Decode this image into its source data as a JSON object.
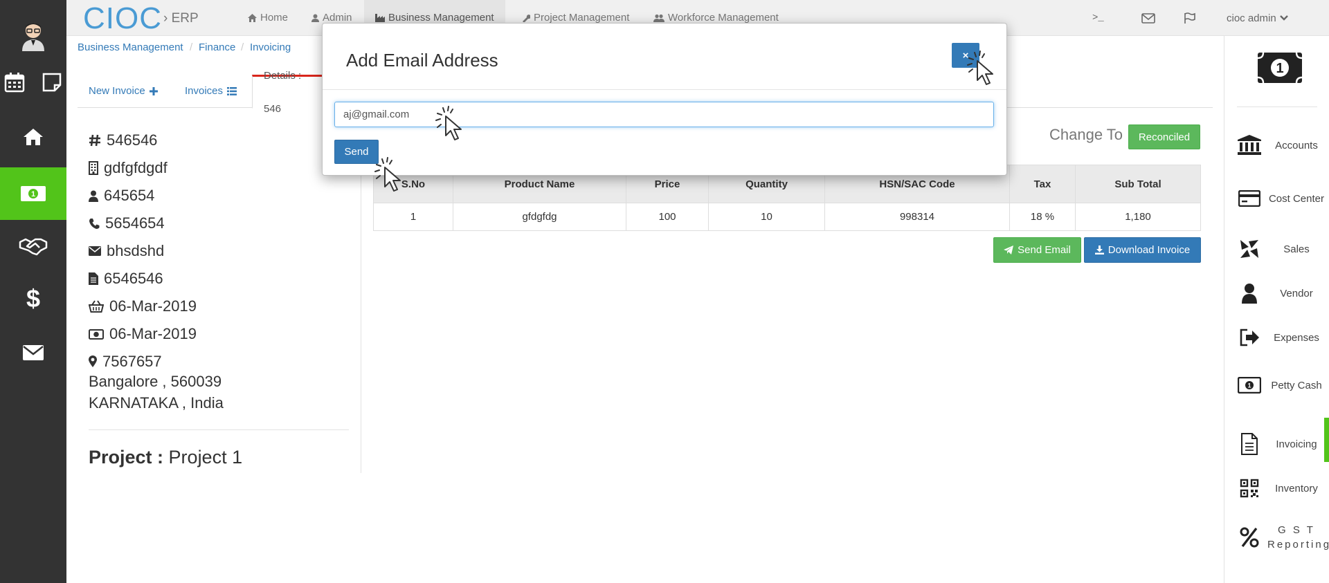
{
  "app": {
    "brand": "CIOC",
    "brand_sub": "ERP"
  },
  "topnav": {
    "items": [
      {
        "label": "Home",
        "icon": "home-icon"
      },
      {
        "label": "Admin",
        "icon": "user-icon"
      },
      {
        "label": "Business Management",
        "icon": "industry-icon",
        "active": true
      },
      {
        "label": "Project Management",
        "icon": "wrench-icon"
      },
      {
        "label": "Workforce Management",
        "icon": "users-icon"
      }
    ],
    "terminal_glyph": ">_",
    "user_label": "cioc admin"
  },
  "breadcrumb": [
    "Business Management",
    "Finance",
    "Invoicing"
  ],
  "tabs": [
    {
      "label": "New Invoice",
      "icon": "plus-icon"
    },
    {
      "label": "Invoices",
      "icon": "list-icon"
    },
    {
      "label": "Details : 546",
      "active": true
    }
  ],
  "details": {
    "invoice_no": "546546",
    "company": "gdfgfdgdf",
    "contact_person": "645654",
    "phone": "5654654",
    "email": "bhsdshd",
    "document": "6546546",
    "order_date": "06-Mar-2019",
    "payment_date": "06-Mar-2019",
    "pincode": "7567657",
    "address_line1": "Bangalore , 560039",
    "address_line2": "KARNATAKA , India",
    "project_label": "Project :",
    "project_value": "Project 1"
  },
  "status": {
    "change_to_label": "Change To",
    "reconciled_button": "Reconciled"
  },
  "table": {
    "headers": [
      "S.No",
      "Product Name",
      "Price",
      "Quantity",
      "HSN/SAC Code",
      "Tax",
      "Sub Total"
    ],
    "rows": [
      [
        "1",
        "gfdgfdg",
        "100",
        "10",
        "998314",
        "18 %",
        "1,180"
      ]
    ]
  },
  "actions": {
    "send_email": "Send Email",
    "download_invoice": "Download Invoice"
  },
  "right_sidebar": {
    "items": [
      {
        "label": "Accounts",
        "icon": "bank-icon"
      },
      {
        "label": "Cost Center",
        "icon": "credit-card-icon"
      },
      {
        "label": "Sales",
        "icon": "sales-icon"
      },
      {
        "label": "Vendor",
        "icon": "user-icon"
      },
      {
        "label": "Expenses",
        "icon": "sign-out-icon"
      },
      {
        "label": "Petty Cash",
        "icon": "money-icon"
      },
      {
        "label": "Invoicing",
        "icon": "file-text-icon",
        "active": true
      },
      {
        "label": "Inventory",
        "icon": "qrcode-icon"
      },
      {
        "label": "G S T Reporting",
        "icon": "percent-icon"
      }
    ]
  },
  "modal": {
    "title": "Add Email Address",
    "close_glyph": "×",
    "email_value": "aj@gmail.com",
    "send_label": "Send"
  },
  "colors": {
    "accent_green": "#52c41a",
    "brand_blue": "#4a9bd4",
    "primary": "#337ab7",
    "success": "#5cb85c",
    "sidebar_dark": "#333333"
  }
}
